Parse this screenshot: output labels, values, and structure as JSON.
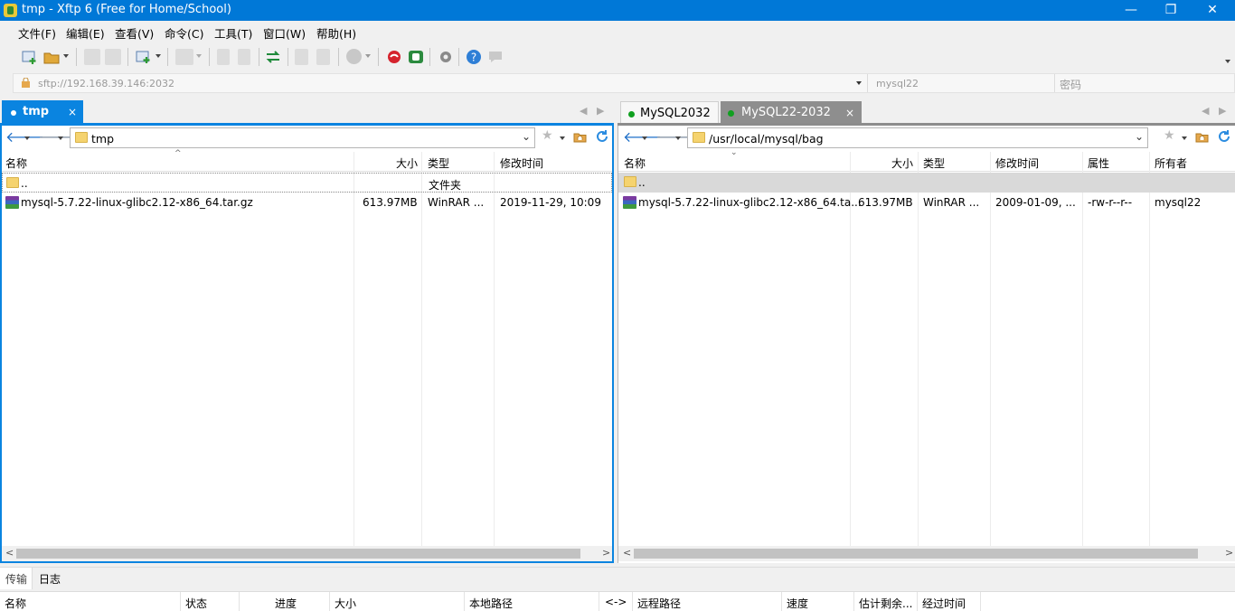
{
  "window": {
    "title": "tmp - Xftp 6 (Free for Home/School)",
    "minimize": "—",
    "maximize": "❐",
    "close": "✕"
  },
  "menu": [
    "文件(F)",
    "编辑(E)",
    "查看(V)",
    "命令(C)",
    "工具(T)",
    "窗口(W)",
    "帮助(H)"
  ],
  "address": {
    "url": "sftp://192.168.39.146:2032",
    "user": "mysql22",
    "password_placeholder": "密码"
  },
  "left": {
    "tab": {
      "label": "tmp",
      "close": "×"
    },
    "path": "tmp",
    "columns": [
      "名称",
      "大小",
      "类型",
      "修改时间"
    ],
    "rows": [
      {
        "name": "..",
        "size": "",
        "type": "文件夹",
        "modified": ""
      },
      {
        "name": "mysql-5.7.22-linux-glibc2.12-x86_64.tar.gz",
        "size": "613.97MB",
        "type": "WinRAR ...",
        "modified": "2019-11-29, 10:09"
      }
    ]
  },
  "right": {
    "tabs": [
      {
        "label": "MySQL2032"
      },
      {
        "label": "MySQL22-2032",
        "close": "×"
      }
    ],
    "path": "/usr/local/mysql/bag",
    "columns": [
      "名称",
      "大小",
      "类型",
      "修改时间",
      "属性",
      "所有者"
    ],
    "rows": [
      {
        "name": "..",
        "size": "",
        "type": "",
        "modified": "",
        "attr": "",
        "owner": ""
      },
      {
        "name": "mysql-5.7.22-linux-glibc2.12-x86_64.ta...",
        "size": "613.97MB",
        "type": "WinRAR ...",
        "modified": "2009-01-09, ...",
        "attr": "-rw-r--r--",
        "owner": "mysql22"
      }
    ]
  },
  "bottom": {
    "tabs": [
      "传输",
      "日志"
    ],
    "columns": [
      "名称",
      "状态",
      "进度",
      "大小",
      "本地路径",
      "<->",
      "远程路径",
      "速度",
      "估计剩余...",
      "经过时间"
    ]
  },
  "colors": {
    "accent": "#0a84e0",
    "titlebar": "#0078d7"
  }
}
